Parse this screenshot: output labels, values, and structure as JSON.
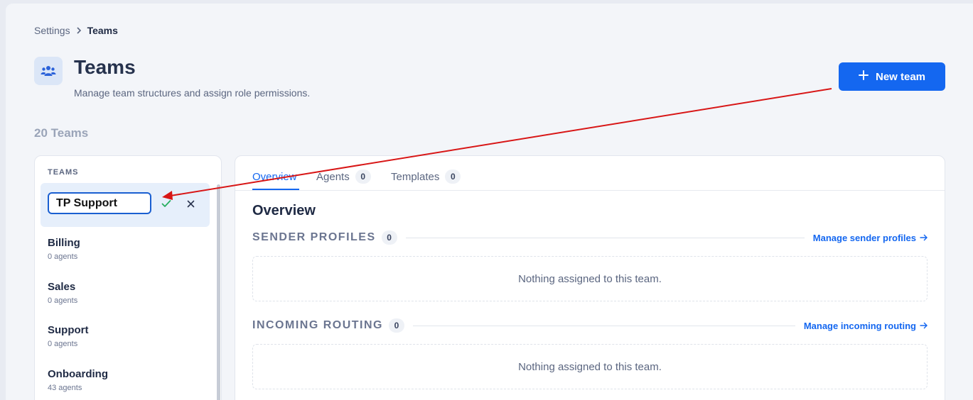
{
  "breadcrumb": {
    "parent": "Settings",
    "current": "Teams"
  },
  "header": {
    "title": "Teams",
    "subtitle": "Manage team structures and assign role permissions.",
    "new_team_label": "New team"
  },
  "team_count": "20 Teams",
  "teams_panel": {
    "header": "TEAMS",
    "editing_value": "TP Support",
    "items": [
      {
        "name": "Billing",
        "agents": "0 agents"
      },
      {
        "name": "Sales",
        "agents": "0 agents"
      },
      {
        "name": "Support",
        "agents": "0 agents"
      },
      {
        "name": "Onboarding",
        "agents": "43 agents"
      }
    ]
  },
  "tabs": [
    {
      "label": "Overview"
    },
    {
      "label": "Agents",
      "count": "0"
    },
    {
      "label": "Templates",
      "count": "0"
    }
  ],
  "overview": {
    "title": "Overview",
    "sections": [
      {
        "label": "SENDER PROFILES",
        "count": "0",
        "link": "Manage sender profiles",
        "empty": "Nothing assigned to this team."
      },
      {
        "label": "INCOMING ROUTING",
        "count": "0",
        "link": "Manage incoming routing",
        "empty": "Nothing assigned to this team."
      }
    ]
  },
  "colors": {
    "accent": "#1467f0",
    "annotation_arrow": "#d81616",
    "confirm": "#27ae60"
  }
}
